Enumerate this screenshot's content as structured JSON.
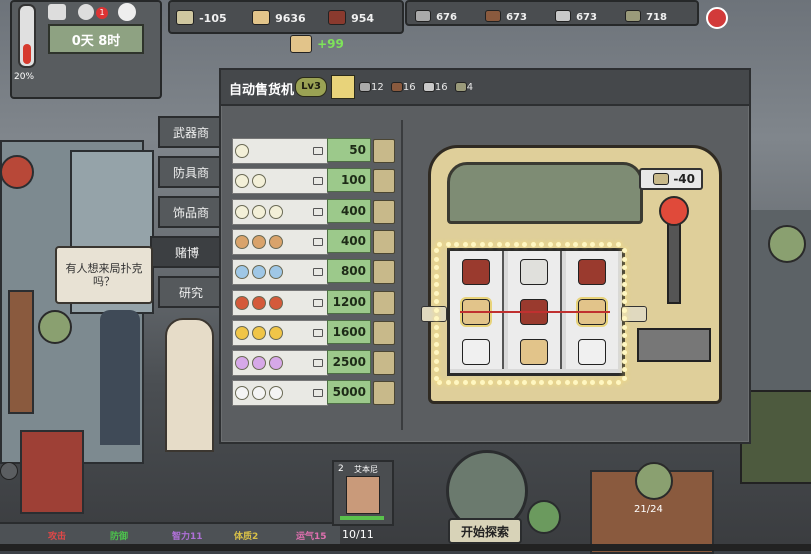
{
  "time_panel": {
    "day_time": "0天 8时",
    "temperature": "20%",
    "alert_count": "1"
  },
  "resources_top": [
    {
      "icon": "food-icon",
      "value": "-105"
    },
    {
      "icon": "gold-bread-icon",
      "value": "9636"
    },
    {
      "icon": "water-can-icon",
      "value": "954"
    }
  ],
  "materials_top": [
    {
      "icon": "stone-icon",
      "value": "676"
    },
    {
      "icon": "wood-icon",
      "value": "673"
    },
    {
      "icon": "metal-icon",
      "value": "673"
    },
    {
      "icon": "parts-icon",
      "value": "718"
    }
  ],
  "gain_popup": "+99",
  "dialog": {
    "title": "自动售货机",
    "level": "Lv3",
    "upgrade_costs": [
      {
        "icon": "stone-icon",
        "value": "12"
      },
      {
        "icon": "wood-icon",
        "value": "16"
      },
      {
        "icon": "metal-icon",
        "value": "16"
      },
      {
        "icon": "parts-icon",
        "value": "4"
      }
    ]
  },
  "tabs": [
    {
      "label": "武器商",
      "active": false
    },
    {
      "label": "防具商",
      "active": false
    },
    {
      "label": "饰品商",
      "active": false
    },
    {
      "label": "赌博",
      "active": true
    },
    {
      "label": "研究",
      "active": false
    }
  ],
  "shop_rows": [
    {
      "item": "flower-token-x1",
      "count": 1,
      "color": "#f3f0d8",
      "price": "50"
    },
    {
      "item": "flower-token-x2",
      "count": 2,
      "color": "#f3f0d8",
      "price": "100"
    },
    {
      "item": "flower-token-x3",
      "count": 3,
      "color": "#f3f0d8",
      "price": "400"
    },
    {
      "item": "copper-coin-x3",
      "count": 3,
      "color": "#d9a36b",
      "price": "400"
    },
    {
      "item": "blue-card-x3",
      "count": 3,
      "color": "#9fc7e6",
      "price": "800"
    },
    {
      "item": "red-bag-x3",
      "count": 3,
      "color": "#d45a3a",
      "price": "1200"
    },
    {
      "item": "gold-bar-x3",
      "count": 3,
      "color": "#f0c548",
      "price": "1600"
    },
    {
      "item": "purple-gem-x3",
      "count": 3,
      "color": "#d6a8e8",
      "price": "2500"
    },
    {
      "item": "diamond-x3",
      "count": 3,
      "color": "#f4f4f4",
      "price": "5000"
    }
  ],
  "slot_machine": {
    "cost": "-40"
  },
  "npc_speech": "有人想来局扑克吗？",
  "character": {
    "level": "2",
    "name": "艾本尼",
    "count": "10/11"
  },
  "bottom_stats": [
    {
      "label": "攻击",
      "color": "#e04848"
    },
    {
      "label": "防御",
      "color": "#4cc24c"
    },
    {
      "label": "智力11",
      "color": "#b070d8"
    },
    {
      "label": "体质2",
      "color": "#d8c048"
    },
    {
      "label": "运气15",
      "color": "#e070b0"
    }
  ],
  "explore_button": "开始探索",
  "right_counter": "21/24"
}
